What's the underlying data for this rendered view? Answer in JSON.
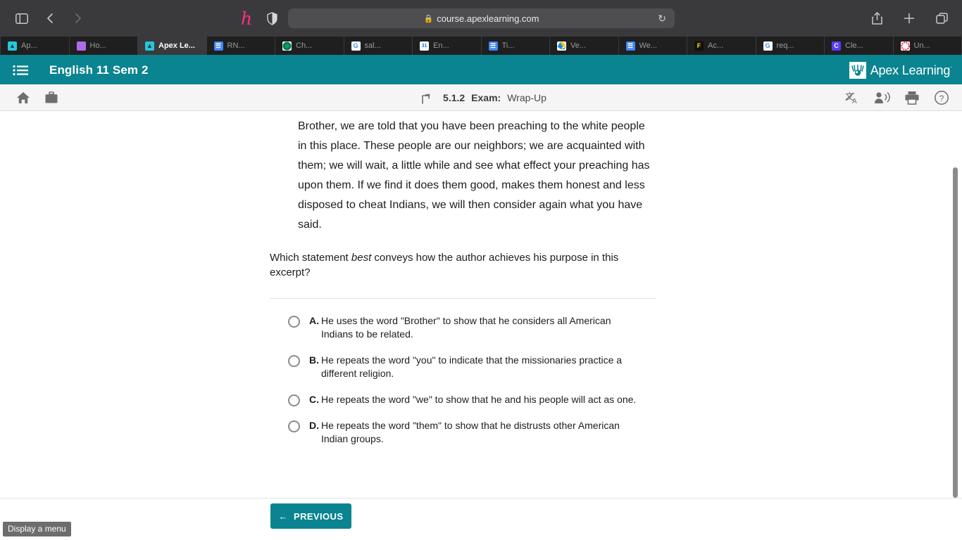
{
  "browser": {
    "sidebar_toggle": "sidebar-toggle",
    "back": "back",
    "forward": "forward",
    "extensions": [
      {
        "name": "honey-extension",
        "glyph": "h"
      },
      {
        "name": "shield-extension",
        "glyph": "shield"
      }
    ],
    "url": "course.apexlearning.com",
    "lock": "lock-icon",
    "reload": "reload-icon",
    "right_actions": [
      "share-icon",
      "new-tab-icon",
      "tab-overview-icon"
    ],
    "tabs": [
      {
        "label": "Ap...",
        "favicon": "apex",
        "active": false
      },
      {
        "label": "Ho...",
        "favicon": "ho",
        "active": false
      },
      {
        "label": "Apex Le...",
        "favicon": "apex",
        "active": true
      },
      {
        "label": "RN...",
        "favicon": "docs",
        "active": false
      },
      {
        "label": "Ch...",
        "favicon": "ch",
        "active": false
      },
      {
        "label": "sal...",
        "favicon": "google",
        "active": false
      },
      {
        "label": "En...",
        "favicon": "cal",
        "active": false
      },
      {
        "label": "Ti...",
        "favicon": "docs",
        "active": false
      },
      {
        "label": "Ve...",
        "favicon": "drive",
        "active": false
      },
      {
        "label": "We...",
        "favicon": "docs",
        "active": false
      },
      {
        "label": "Ac...",
        "favicon": "f",
        "active": false
      },
      {
        "label": "req...",
        "favicon": "google",
        "active": false
      },
      {
        "label": "Cle...",
        "favicon": "c",
        "active": false
      },
      {
        "label": "Un...",
        "favicon": "un",
        "active": false
      }
    ]
  },
  "app_header": {
    "menu_icon": "list-menu-icon",
    "course_title": "English 11 Sem 2",
    "brand_name": "Apex Learning",
    "brand_tm": "·",
    "color": "#0a8490"
  },
  "sub_toolbar": {
    "home_icon": "home-icon",
    "briefcase_icon": "briefcase-icon",
    "up_icon": "up-arrow-icon",
    "breadcrumb_number": "5.1.2",
    "breadcrumb_type": "Exam:",
    "breadcrumb_name": "Wrap-Up",
    "right_icons": [
      "translate-icon",
      "read-aloud-icon",
      "print-icon",
      "help-icon"
    ]
  },
  "content": {
    "passage": "Brother, we are told that you have been preaching to the white people in this place. These people are our neighbors; we are acquainted with them; we will wait, a little while and see what effect your preaching has upon them. If we find it does them good, makes them honest and less disposed to cheat Indians, we will then consider again what you have said.",
    "question_prefix": "Which statement ",
    "question_emphasis": "best",
    "question_suffix": " conveys how the author achieves his purpose in this excerpt?",
    "options": [
      {
        "letter": "A.",
        "text": "He uses the word \"Brother\" to show that he considers all American Indians to be related.",
        "selected": false
      },
      {
        "letter": "B.",
        "text": "He repeats the word \"you\" to indicate that the missionaries practice a different religion.",
        "selected": false
      },
      {
        "letter": "C.",
        "text": "He repeats the word \"we\" to show that he and his people will act as one.",
        "selected": false
      },
      {
        "letter": "D.",
        "text": "He repeats the word \"them\" to show that he distrusts other American Indian groups.",
        "selected": false
      }
    ]
  },
  "bottom": {
    "previous_label": "PREVIOUS",
    "previous_arrow": "←",
    "status_tooltip": "Display a menu"
  }
}
